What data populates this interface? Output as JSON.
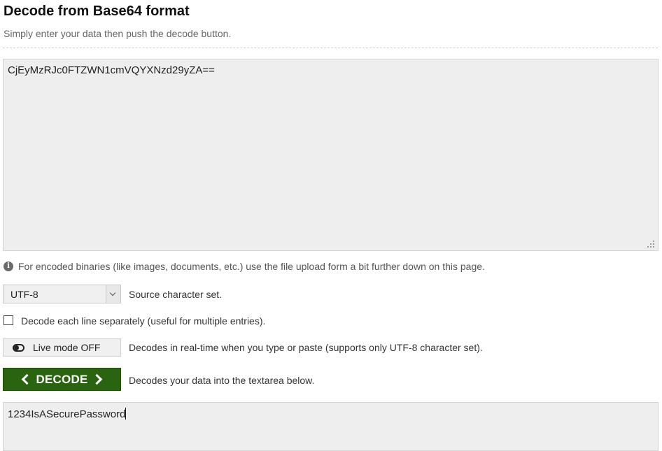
{
  "header": {
    "title": "Decode from Base64 format",
    "subtitle": "Simply enter your data then push the decode button."
  },
  "input": {
    "value": "CjEyMzRJc0FTZWN1cmVQYXNzd29yZA=="
  },
  "info": {
    "icon": "info-circle-icon",
    "text": "For encoded binaries (like images, documents, etc.) use the file upload form a bit further down on this page."
  },
  "charset": {
    "selected": "UTF-8",
    "label": "Source character set."
  },
  "line_option": {
    "checked": false,
    "label": "Decode each line separately (useful for multiple entries)."
  },
  "live_mode": {
    "button_label": "Live mode OFF",
    "icon": "toggle-off-icon",
    "description": "Decodes in real-time when you type or paste (supports only UTF-8 character set)."
  },
  "decode": {
    "button_label": "DECODE",
    "description": "Decodes your data into the textarea below.",
    "color": "#2b6410"
  },
  "output": {
    "value": "1234IsASecurePassword"
  }
}
